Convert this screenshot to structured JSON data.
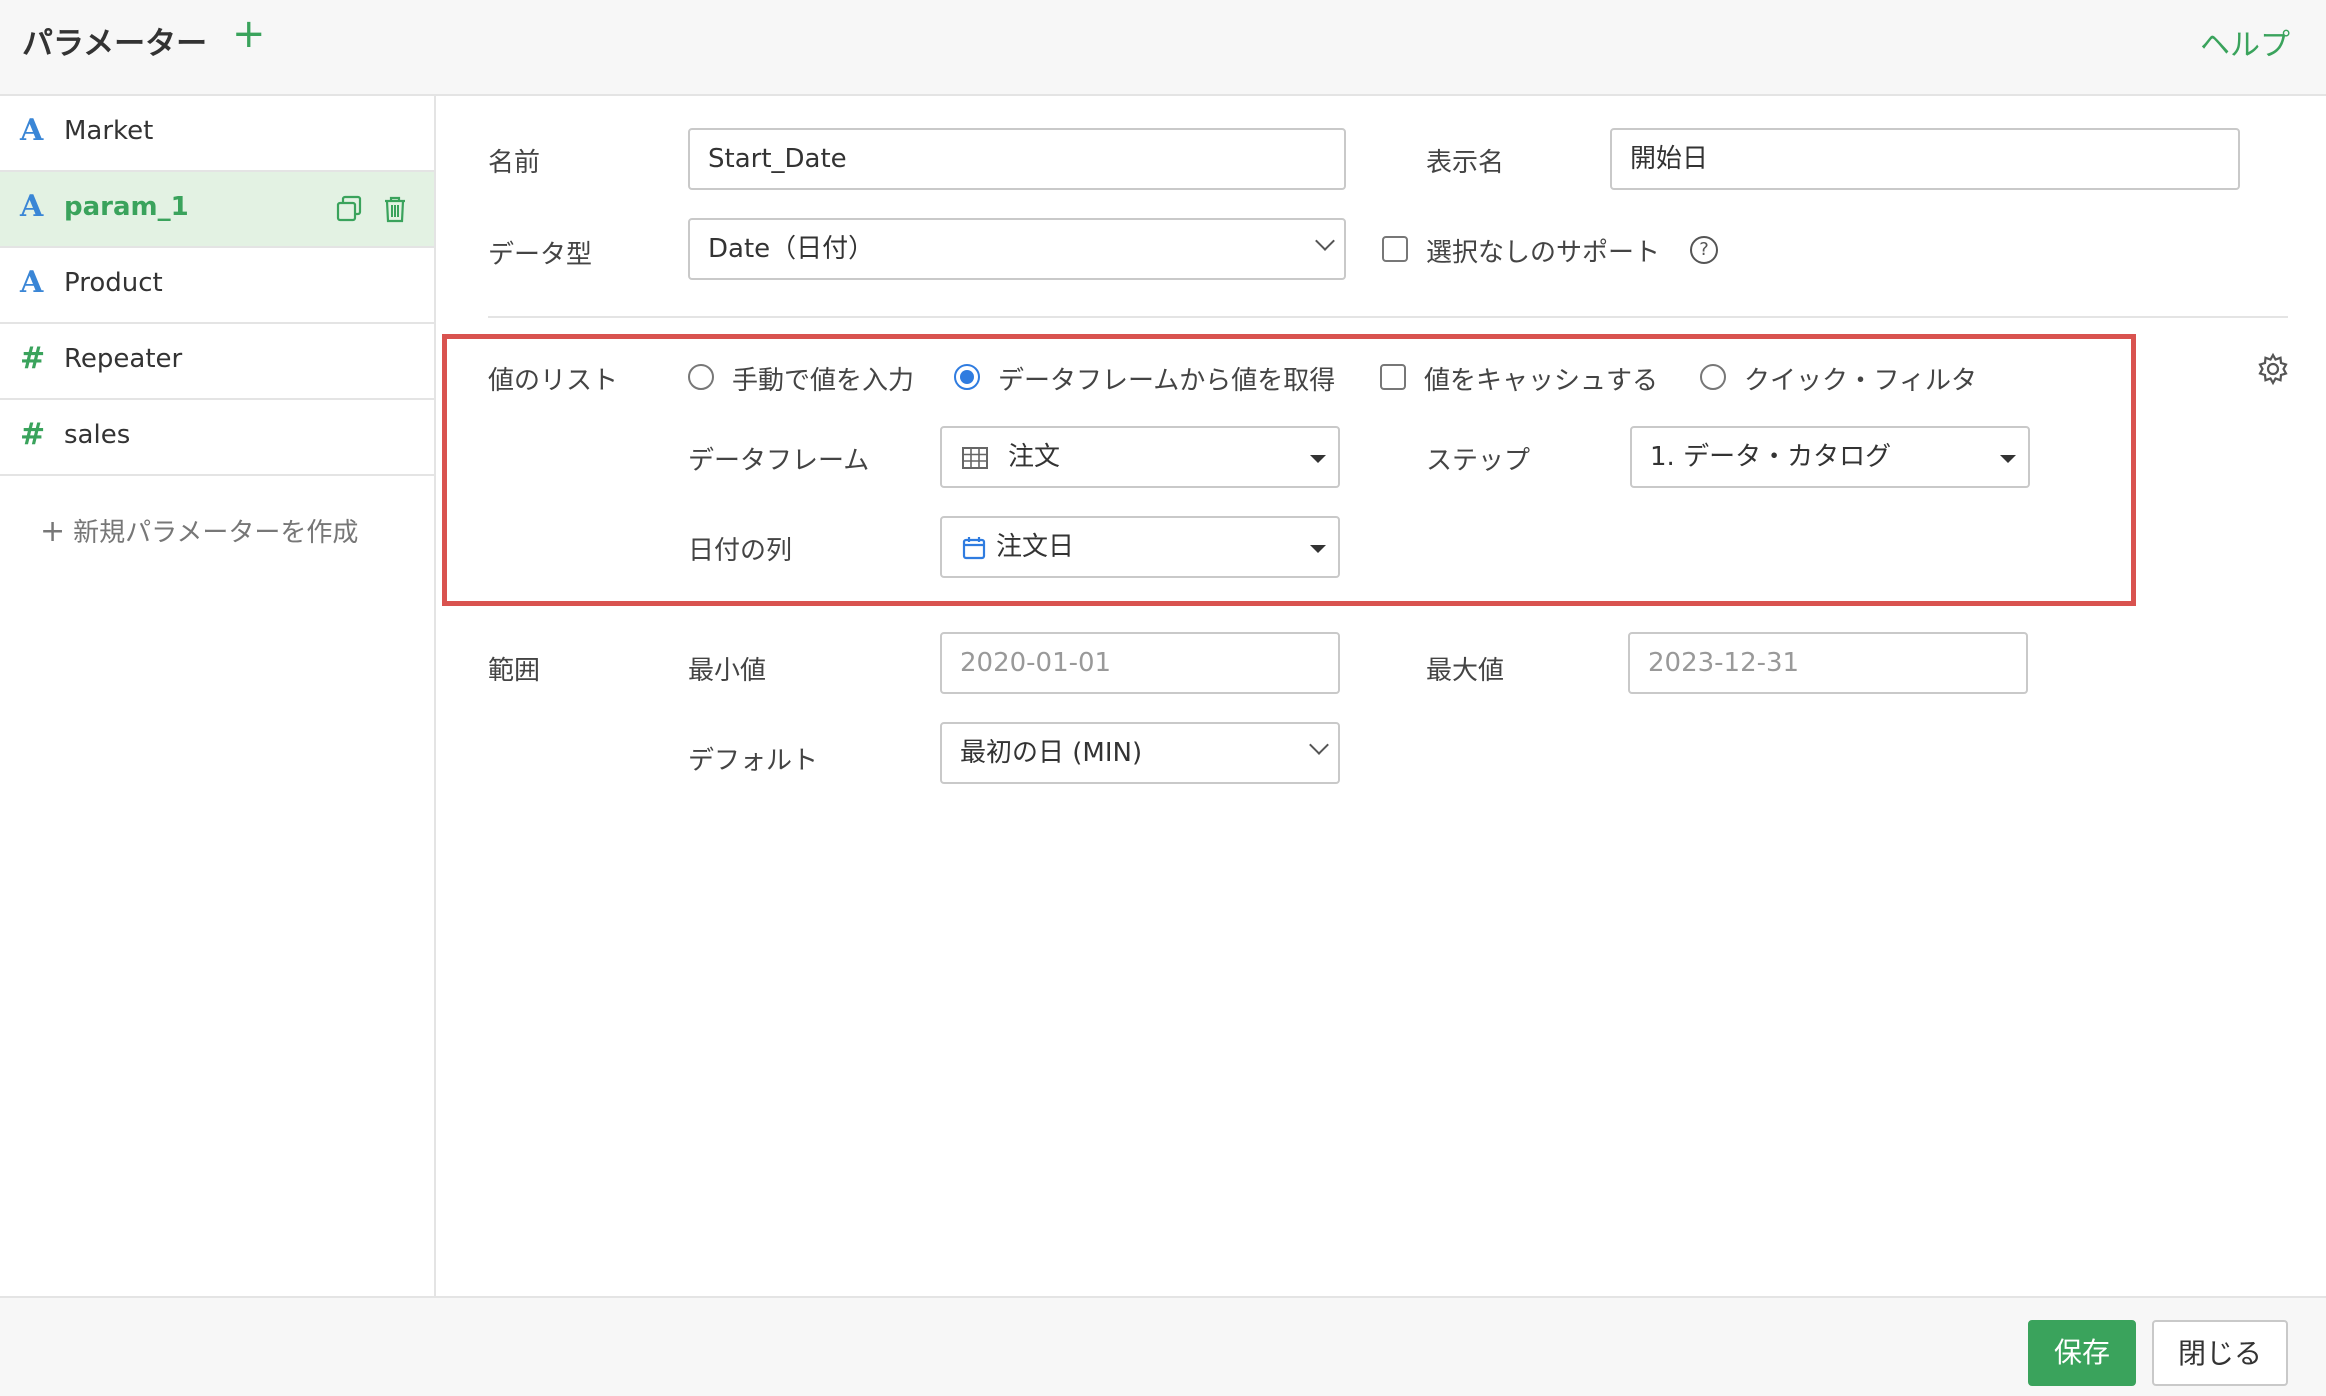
{
  "header": {
    "title": "パラメーター",
    "add_icon": "+",
    "help": "ヘルプ"
  },
  "sidebar": {
    "items": [
      {
        "type": "A",
        "label": "Market"
      },
      {
        "type": "A",
        "label": "param_1",
        "active": true
      },
      {
        "type": "A",
        "label": "Product"
      },
      {
        "type": "#",
        "label": "Repeater"
      },
      {
        "type": "#",
        "label": "sales"
      }
    ],
    "new_param": "新規パラメーターを作成"
  },
  "form": {
    "name_label": "名前",
    "name_value": "Start_Date",
    "display_name_label": "表示名",
    "display_name_value": "開始日",
    "data_type_label": "データ型",
    "data_type_value": "Date（日付）",
    "no_selection_support": "選択なしのサポート",
    "value_list_label": "値のリスト",
    "radio_manual": "手動で値を入力",
    "radio_dataframe": "データフレームから値を取得",
    "cache_values": "値をキャッシュする",
    "radio_quick_filter": "クイック・フィルタ",
    "dataframe_label": "データフレーム",
    "dataframe_value": "注文",
    "step_label": "ステップ",
    "step_value": "1. データ・カタログ",
    "date_column_label": "日付の列",
    "date_column_value": "注文日",
    "range_label": "範囲",
    "min_label": "最小値",
    "min_placeholder": "2020-01-01",
    "max_label": "最大値",
    "max_placeholder": "2023-12-31",
    "default_label": "デフォルト",
    "default_value": "最初の日 (MIN)"
  },
  "footer": {
    "save": "保存",
    "close": "閉じる"
  },
  "colors": {
    "accent": "#3aa35c",
    "type_a": "#3a86d6",
    "radio": "#2f7ce0",
    "highlight": "#d9534f"
  }
}
